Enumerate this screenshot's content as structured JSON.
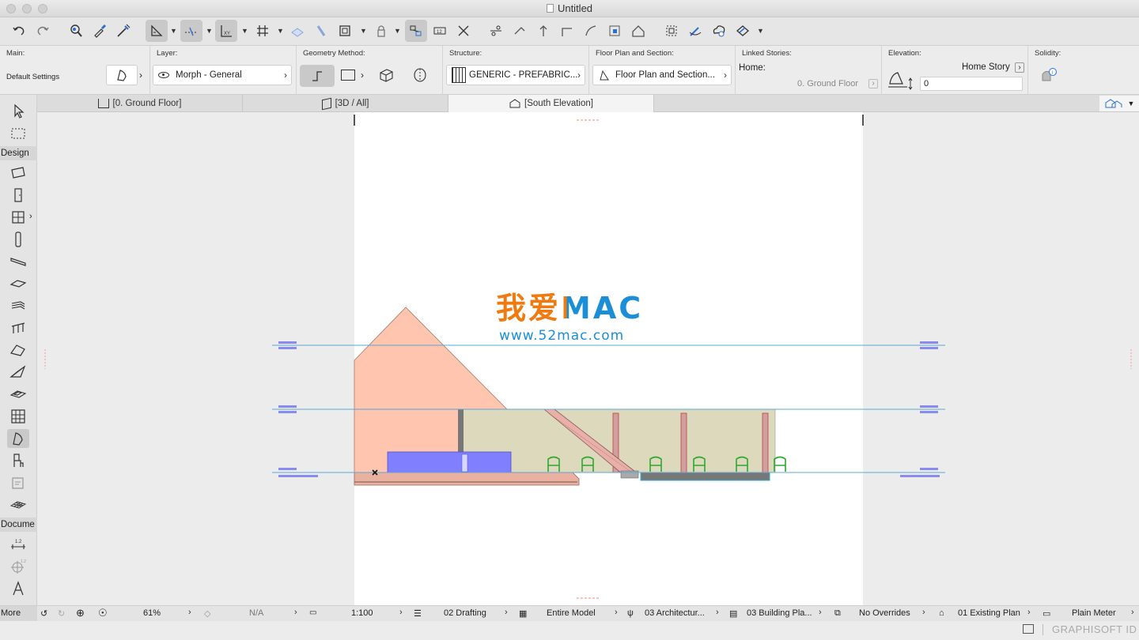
{
  "window": {
    "title": "Untitled"
  },
  "toolbar": {
    "undo": "undo-icon",
    "redo": "redo-icon"
  },
  "infobox": {
    "main": {
      "label": "Main:",
      "value": "Default Settings"
    },
    "layer": {
      "label": "Layer:",
      "value": "Morph - General"
    },
    "geometry": {
      "label": "Geometry Method:"
    },
    "structure": {
      "label": "Structure:",
      "value": "GENERIC - PREFABRIC..."
    },
    "floorplan": {
      "label": "Floor Plan and Section:",
      "value": "Floor Plan and Section..."
    },
    "linked": {
      "label": "Linked Stories:",
      "home_label": "Home:",
      "home_value": "0. Ground Floor"
    },
    "elevation": {
      "label": "Elevation:",
      "home_story": "Home Story",
      "value": "0"
    },
    "solidity": {
      "label": "Solidity:"
    }
  },
  "tabs": [
    {
      "label": "[0. Ground Floor]"
    },
    {
      "label": "[3D / All]"
    },
    {
      "label": "[South Elevation]"
    }
  ],
  "sidebar": {
    "design": "Design",
    "document": "Docume",
    "more": "More"
  },
  "watermark": {
    "title": "我爱MAC",
    "url": "www.52mac.com"
  },
  "status": {
    "zoom": "61%",
    "angle": "N/A",
    "scale": "1:100",
    "layer_combo": "02 Drafting",
    "model_filter": "Entire Model",
    "pen_set": "03 Architectur...",
    "mvo": "03 Building Pla...",
    "overrides": "No Overrides",
    "renovation": "01 Existing Plan",
    "dimension": "Plain Meter"
  },
  "footer": {
    "brand": "GRAPHISOFT ID"
  },
  "colors": {
    "accent": "#8080ff",
    "morph": "#ffc5ae",
    "wall": "#dcd9bc",
    "chair": "#2da82d"
  }
}
